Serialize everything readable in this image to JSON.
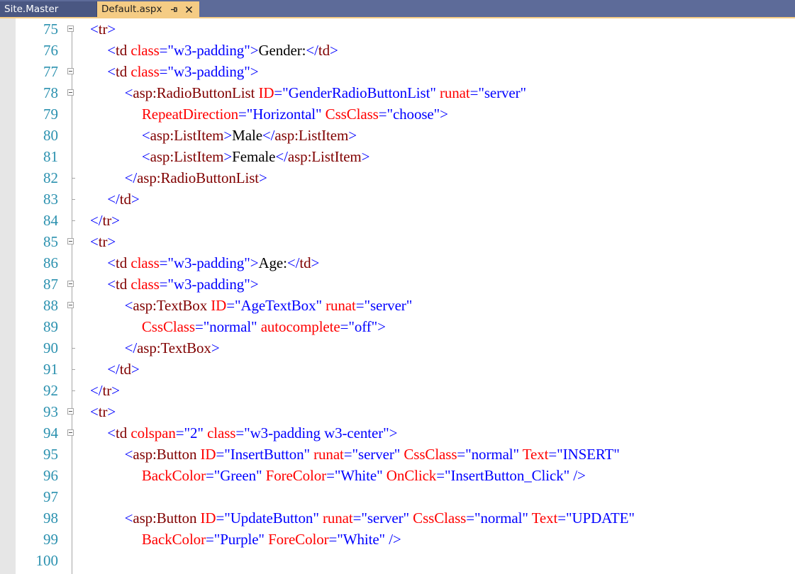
{
  "tabs": [
    {
      "label": "Site.Master",
      "active": false
    },
    {
      "label": "Default.aspx",
      "active": true
    }
  ],
  "icons": {
    "pin": "pin-icon",
    "close": "close-icon"
  },
  "colors": {
    "delimiter": "#0000ff",
    "tag_name": "#800000",
    "attribute": "#ff0000",
    "attribute_value": "#0000ff",
    "text": "#000000",
    "line_number": "#2b91af",
    "tab_bar": "#5d6b99",
    "active_tab": "#f5cc84"
  },
  "lines": [
    {
      "n": "75",
      "fold": true,
      "indent": 5,
      "tokens": [
        [
          "d",
          "<"
        ],
        [
          "t",
          "tr"
        ],
        [
          "d",
          ">"
        ]
      ]
    },
    {
      "n": "76",
      "fold": false,
      "indent": 6,
      "tokens": [
        [
          "d",
          "<"
        ],
        [
          "t",
          "td"
        ],
        [
          "x",
          " "
        ],
        [
          "a",
          "class"
        ],
        [
          "d",
          "="
        ],
        [
          "v",
          "\"w3-padding\""
        ],
        [
          "d",
          ">"
        ],
        [
          "x",
          "Gender:"
        ],
        [
          "d",
          "</"
        ],
        [
          "t",
          "td"
        ],
        [
          "d",
          ">"
        ]
      ]
    },
    {
      "n": "77",
      "fold": true,
      "indent": 6,
      "tokens": [
        [
          "d",
          "<"
        ],
        [
          "t",
          "td"
        ],
        [
          "x",
          " "
        ],
        [
          "a",
          "class"
        ],
        [
          "d",
          "="
        ],
        [
          "v",
          "\"w3-padding\""
        ],
        [
          "d",
          ">"
        ]
      ]
    },
    {
      "n": "78",
      "fold": true,
      "indent": 7,
      "tokens": [
        [
          "d",
          "<"
        ],
        [
          "t",
          "asp:RadioButtonList"
        ],
        [
          "x",
          " "
        ],
        [
          "a",
          "ID"
        ],
        [
          "d",
          "="
        ],
        [
          "v",
          "\"GenderRadioButtonList\""
        ],
        [
          "x",
          " "
        ],
        [
          "a",
          "runat"
        ],
        [
          "d",
          "="
        ],
        [
          "v",
          "\"server\""
        ]
      ]
    },
    {
      "n": "79",
      "fold": false,
      "indent": 8,
      "tokens": [
        [
          "a",
          "RepeatDirection"
        ],
        [
          "d",
          "="
        ],
        [
          "v",
          "\"Horizontal\""
        ],
        [
          "x",
          " "
        ],
        [
          "a",
          "CssClass"
        ],
        [
          "d",
          "="
        ],
        [
          "v",
          "\"choose\""
        ],
        [
          "d",
          ">"
        ]
      ]
    },
    {
      "n": "80",
      "fold": false,
      "indent": 8,
      "tokens": [
        [
          "d",
          "<"
        ],
        [
          "t",
          "asp:ListItem"
        ],
        [
          "d",
          ">"
        ],
        [
          "x",
          "Male"
        ],
        [
          "d",
          "</"
        ],
        [
          "t",
          "asp:ListItem"
        ],
        [
          "d",
          ">"
        ]
      ]
    },
    {
      "n": "81",
      "fold": false,
      "indent": 8,
      "tokens": [
        [
          "d",
          "<"
        ],
        [
          "t",
          "asp:ListItem"
        ],
        [
          "d",
          ">"
        ],
        [
          "x",
          "Female"
        ],
        [
          "d",
          "</"
        ],
        [
          "t",
          "asp:ListItem"
        ],
        [
          "d",
          ">"
        ]
      ]
    },
    {
      "n": "82",
      "fold": false,
      "tick": true,
      "indent": 7,
      "tokens": [
        [
          "d",
          "</"
        ],
        [
          "t",
          "asp:RadioButtonList"
        ],
        [
          "d",
          ">"
        ]
      ]
    },
    {
      "n": "83",
      "fold": false,
      "tick": true,
      "indent": 6,
      "tokens": [
        [
          "d",
          "</"
        ],
        [
          "t",
          "td"
        ],
        [
          "d",
          ">"
        ]
      ]
    },
    {
      "n": "84",
      "fold": false,
      "tick": true,
      "indent": 5,
      "tokens": [
        [
          "d",
          "</"
        ],
        [
          "t",
          "tr"
        ],
        [
          "d",
          ">"
        ]
      ]
    },
    {
      "n": "85",
      "fold": true,
      "indent": 5,
      "tokens": [
        [
          "d",
          "<"
        ],
        [
          "t",
          "tr"
        ],
        [
          "d",
          ">"
        ]
      ]
    },
    {
      "n": "86",
      "fold": false,
      "indent": 6,
      "tokens": [
        [
          "d",
          "<"
        ],
        [
          "t",
          "td"
        ],
        [
          "x",
          " "
        ],
        [
          "a",
          "class"
        ],
        [
          "d",
          "="
        ],
        [
          "v",
          "\"w3-padding\""
        ],
        [
          "d",
          ">"
        ],
        [
          "x",
          "Age:"
        ],
        [
          "d",
          "</"
        ],
        [
          "t",
          "td"
        ],
        [
          "d",
          ">"
        ]
      ]
    },
    {
      "n": "87",
      "fold": true,
      "indent": 6,
      "tokens": [
        [
          "d",
          "<"
        ],
        [
          "t",
          "td"
        ],
        [
          "x",
          " "
        ],
        [
          "a",
          "class"
        ],
        [
          "d",
          "="
        ],
        [
          "v",
          "\"w3-padding\""
        ],
        [
          "d",
          ">"
        ]
      ]
    },
    {
      "n": "88",
      "fold": true,
      "indent": 7,
      "tokens": [
        [
          "d",
          "<"
        ],
        [
          "t",
          "asp:TextBox"
        ],
        [
          "x",
          " "
        ],
        [
          "a",
          "ID"
        ],
        [
          "d",
          "="
        ],
        [
          "v",
          "\"AgeTextBox\""
        ],
        [
          "x",
          " "
        ],
        [
          "a",
          "runat"
        ],
        [
          "d",
          "="
        ],
        [
          "v",
          "\"server\""
        ]
      ]
    },
    {
      "n": "89",
      "fold": false,
      "indent": 8,
      "tokens": [
        [
          "a",
          "CssClass"
        ],
        [
          "d",
          "="
        ],
        [
          "v",
          "\"normal\""
        ],
        [
          "x",
          " "
        ],
        [
          "a",
          "autocomplete"
        ],
        [
          "d",
          "="
        ],
        [
          "v",
          "\"off\""
        ],
        [
          "d",
          ">"
        ]
      ]
    },
    {
      "n": "90",
      "fold": false,
      "tick": true,
      "indent": 7,
      "tokens": [
        [
          "d",
          "</"
        ],
        [
          "t",
          "asp:TextBox"
        ],
        [
          "d",
          ">"
        ]
      ]
    },
    {
      "n": "91",
      "fold": false,
      "tick": true,
      "indent": 6,
      "tokens": [
        [
          "d",
          "</"
        ],
        [
          "t",
          "td"
        ],
        [
          "d",
          ">"
        ]
      ]
    },
    {
      "n": "92",
      "fold": false,
      "tick": true,
      "indent": 5,
      "tokens": [
        [
          "d",
          "</"
        ],
        [
          "t",
          "tr"
        ],
        [
          "d",
          ">"
        ]
      ]
    },
    {
      "n": "93",
      "fold": true,
      "indent": 5,
      "tokens": [
        [
          "d",
          "<"
        ],
        [
          "t",
          "tr"
        ],
        [
          "d",
          ">"
        ]
      ]
    },
    {
      "n": "94",
      "fold": true,
      "indent": 6,
      "tokens": [
        [
          "d",
          "<"
        ],
        [
          "t",
          "td"
        ],
        [
          "x",
          " "
        ],
        [
          "a",
          "colspan"
        ],
        [
          "d",
          "="
        ],
        [
          "v",
          "\"2\""
        ],
        [
          "x",
          " "
        ],
        [
          "a",
          "class"
        ],
        [
          "d",
          "="
        ],
        [
          "v",
          "\"w3-padding w3-center\""
        ],
        [
          "d",
          ">"
        ]
      ]
    },
    {
      "n": "95",
      "fold": false,
      "indent": 7,
      "tokens": [
        [
          "d",
          "<"
        ],
        [
          "t",
          "asp:Button"
        ],
        [
          "x",
          " "
        ],
        [
          "a",
          "ID"
        ],
        [
          "d",
          "="
        ],
        [
          "v",
          "\"InsertButton\""
        ],
        [
          "x",
          " "
        ],
        [
          "a",
          "runat"
        ],
        [
          "d",
          "="
        ],
        [
          "v",
          "\"server\""
        ],
        [
          "x",
          " "
        ],
        [
          "a",
          "CssClass"
        ],
        [
          "d",
          "="
        ],
        [
          "v",
          "\"normal\""
        ],
        [
          "x",
          " "
        ],
        [
          "a",
          "Text"
        ],
        [
          "d",
          "="
        ],
        [
          "v",
          "\"INSERT\""
        ]
      ]
    },
    {
      "n": "96",
      "fold": false,
      "indent": 8,
      "tokens": [
        [
          "a",
          "BackColor"
        ],
        [
          "d",
          "="
        ],
        [
          "v",
          "\"Green\""
        ],
        [
          "x",
          " "
        ],
        [
          "a",
          "ForeColor"
        ],
        [
          "d",
          "="
        ],
        [
          "v",
          "\"White\""
        ],
        [
          "x",
          " "
        ],
        [
          "a",
          "OnClick"
        ],
        [
          "d",
          "="
        ],
        [
          "v",
          "\"InsertButton_Click\""
        ],
        [
          "x",
          " "
        ],
        [
          "d",
          "/>"
        ]
      ]
    },
    {
      "n": "97",
      "fold": false,
      "indent": 0,
      "tokens": []
    },
    {
      "n": "98",
      "fold": false,
      "indent": 7,
      "tokens": [
        [
          "d",
          "<"
        ],
        [
          "t",
          "asp:Button"
        ],
        [
          "x",
          " "
        ],
        [
          "a",
          "ID"
        ],
        [
          "d",
          "="
        ],
        [
          "v",
          "\"UpdateButton\""
        ],
        [
          "x",
          " "
        ],
        [
          "a",
          "runat"
        ],
        [
          "d",
          "="
        ],
        [
          "v",
          "\"server\""
        ],
        [
          "x",
          " "
        ],
        [
          "a",
          "CssClass"
        ],
        [
          "d",
          "="
        ],
        [
          "v",
          "\"normal\""
        ],
        [
          "x",
          " "
        ],
        [
          "a",
          "Text"
        ],
        [
          "d",
          "="
        ],
        [
          "v",
          "\"UPDATE\""
        ]
      ]
    },
    {
      "n": "99",
      "fold": false,
      "indent": 8,
      "tokens": [
        [
          "a",
          "BackColor"
        ],
        [
          "d",
          "="
        ],
        [
          "v",
          "\"Purple\""
        ],
        [
          "x",
          " "
        ],
        [
          "a",
          "ForeColor"
        ],
        [
          "d",
          "="
        ],
        [
          "v",
          "\"White\""
        ],
        [
          "x",
          " "
        ],
        [
          "d",
          "/>"
        ]
      ]
    },
    {
      "n": "100",
      "fold": false,
      "indent": 0,
      "tokens": []
    }
  ]
}
